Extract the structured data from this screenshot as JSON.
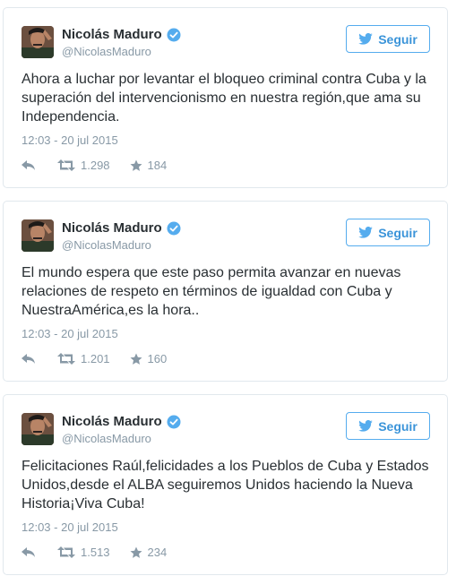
{
  "colors": {
    "accent": "#55acee",
    "name": "#292f33",
    "meta": "#8899a6",
    "border": "#e1e8ed"
  },
  "tweets": [
    {
      "name": "Nicolás Maduro",
      "handle": "@NicolasMaduro",
      "follow_label": "Seguir",
      "text": "Ahora a luchar por levantar el bloqueo criminal contra Cuba y la superación del intervencionismo en nuestra región,que ama su Independencia.",
      "timestamp": "12:03 - 20 jul 2015",
      "retweets": "1.298",
      "favorites": "184"
    },
    {
      "name": "Nicolás Maduro",
      "handle": "@NicolasMaduro",
      "follow_label": "Seguir",
      "text": "El mundo espera que este paso permita avanzar en nuevas relaciones de respeto en términos de igualdad con Cuba y NuestraAmérica,es la hora..",
      "timestamp": "12:03 - 20 jul 2015",
      "retweets": "1.201",
      "favorites": "160"
    },
    {
      "name": "Nicolás Maduro",
      "handle": "@NicolasMaduro",
      "follow_label": "Seguir",
      "text": "Felicitaciones Raúl,felicidades a los Pueblos de Cuba y Estados Unidos,desde el ALBA seguiremos Unidos haciendo la Nueva Historia¡Viva Cuba!",
      "timestamp": "12:03 - 20 jul 2015",
      "retweets": "1.513",
      "favorites": "234"
    }
  ]
}
